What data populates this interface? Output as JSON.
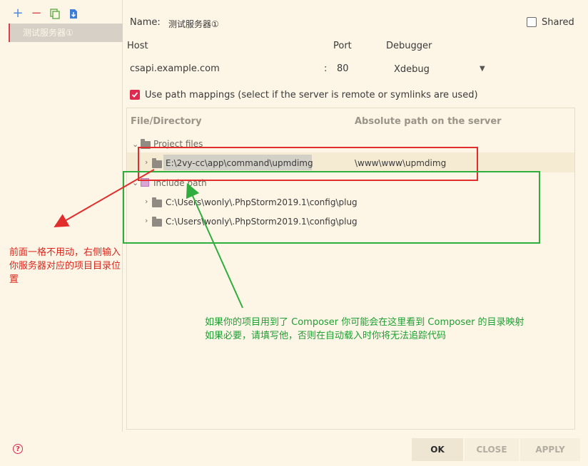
{
  "sidebar": {
    "tool_add": "+",
    "tool_remove": "−",
    "server_item": "测试服务器①"
  },
  "form": {
    "name_label": "Name:",
    "name_value": "测试服务器①",
    "shared_label": "Shared",
    "host_label": "Host",
    "host_value": "csapi.example.com",
    "port_label": "Port",
    "port_separator": ":",
    "port_value": "80",
    "debugger_label": "Debugger",
    "debugger_value": "Xdebug",
    "mappings_label": "Use path mappings (select if the server is remote or symlinks are used)"
  },
  "tree": {
    "col_file": "File/Directory",
    "col_abs": "Absolute path on the server",
    "project_files": "Project files",
    "project_path": "E:\\2vy-cc\\app\\command\\upmdimg",
    "project_server_path": "\\www\\www\\upmdimg",
    "include_path": "Include path",
    "include_item_1": "C:\\Users\\wonly\\.PhpStorm2019.1\\config\\plug",
    "include_item_2": "C:\\Users\\wonly\\.PhpStorm2019.1\\config\\plug"
  },
  "annotations": {
    "red_note": "前面一格不用动，右侧输入你服务器对应的项目目录位置",
    "green_note_line1": "如果你的项目用到了 Composer 你可能会在这里看到 Composer 的目录映射",
    "green_note_line2": "如果必要，请填写他，否则在自动载入时你将无法追踪代码"
  },
  "buttons": {
    "ok": "OK",
    "close": "CLOSE",
    "apply": "APPLY"
  },
  "colors": {
    "accent": "#e0294f",
    "annotation_red": "#e22d2d",
    "annotation_green": "#2fae3d"
  }
}
